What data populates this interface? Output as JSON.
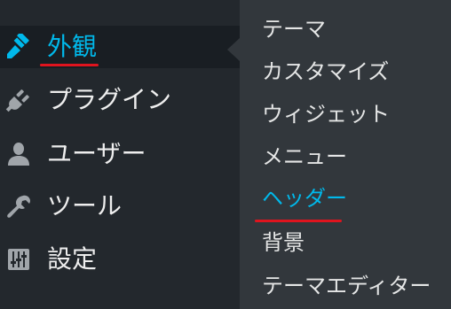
{
  "sidebar": {
    "items": [
      {
        "label": "外観",
        "icon": "paintbrush-icon",
        "active": true
      },
      {
        "label": "プラグイン",
        "icon": "plug-icon"
      },
      {
        "label": "ユーザー",
        "icon": "user-icon"
      },
      {
        "label": "ツール",
        "icon": "wrench-icon"
      },
      {
        "label": "設定",
        "icon": "settings-sliders-icon"
      }
    ]
  },
  "submenu": {
    "items": [
      {
        "label": "テーマ"
      },
      {
        "label": "カスタマイズ"
      },
      {
        "label": "ウィジェット"
      },
      {
        "label": "メニュー"
      },
      {
        "label": "ヘッダー",
        "current": true
      },
      {
        "label": "背景"
      },
      {
        "label": "テーマエディター"
      }
    ]
  },
  "colors": {
    "sidebar_bg": "#23282d",
    "active_bg": "#191e23",
    "submenu_bg": "#32373c",
    "accent": "#00b9eb",
    "highlight_underline": "#e0141e",
    "text": "#eeeeee"
  }
}
